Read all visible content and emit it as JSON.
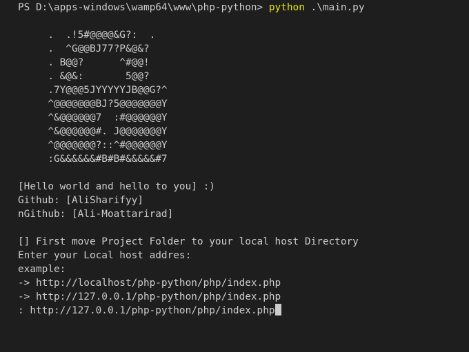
{
  "terminal": {
    "prompt": "PS D:\\apps-windows\\wamp64\\www\\php-python> ",
    "command": "python",
    "command_args": " .\\main.py",
    "ascii_art": [
      "     .  .!5#@@@@&G?:  .",
      "     .  ^G@@BJ77?P&@&?",
      "     . B@@?      ^#@@!",
      "     . &@&:       5@@?",
      "     .7Y@@@5JYYYYYJB@@G?^",
      "     ^@@@@@@@BJ?5@@@@@@@Y",
      "     ^&@@@@@@7  :#@@@@@@Y",
      "     ^&@@@@@@#. J@@@@@@@Y",
      "     ^@@@@@@@?::^#@@@@@@Y",
      "     :G&&&&&&#B#B#&&&&&#7"
    ],
    "hello": "[Hello world and hello to you] :)",
    "github": "Github: [AliSharifyy]",
    "ngithub": "nGithub: [Ali-Moattarirad]",
    "instruction": "[] First move Project Folder to your local host Directory",
    "enter": "Enter your Local host addres:",
    "example_label": "example:",
    "example_1": "-> http://localhost/php-python/php/index.php",
    "example_2": "-> http://127.0.0.1/php-python/php/index.php",
    "input_value": ": http://127.0.0.1/php-python/php/index.php"
  }
}
